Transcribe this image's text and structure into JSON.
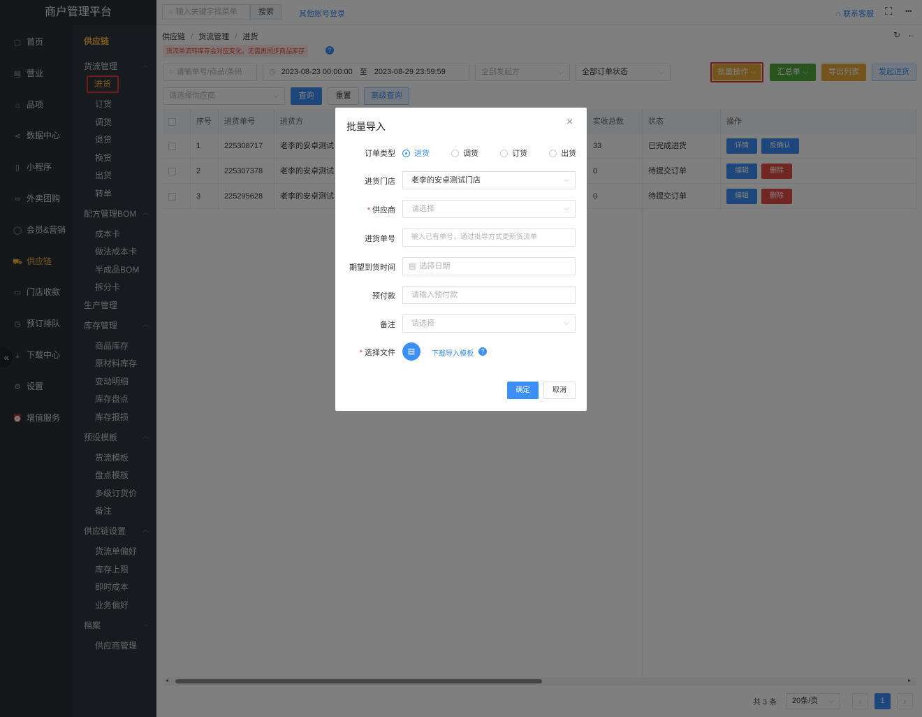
{
  "app": {
    "title": "商户管理平台"
  },
  "nav": {
    "items": [
      {
        "label": "首页",
        "icon": "home-icon",
        "glyph": "▢"
      },
      {
        "label": "营业",
        "icon": "calendar-icon",
        "glyph": "▤"
      },
      {
        "label": "品项",
        "icon": "bag-icon",
        "glyph": "⌂"
      },
      {
        "label": "数据中心",
        "icon": "share-icon",
        "glyph": "⋖"
      },
      {
        "label": "小程序",
        "icon": "phone-icon",
        "glyph": "▯"
      },
      {
        "label": "外卖团购",
        "icon": "bike-icon",
        "glyph": "∞"
      },
      {
        "label": "会员&营销",
        "icon": "user-icon",
        "glyph": "◯"
      },
      {
        "label": "供应链",
        "icon": "truck-icon",
        "glyph": "⛟"
      },
      {
        "label": "门店收款",
        "icon": "wallet-icon",
        "glyph": "▭"
      },
      {
        "label": "预订排队",
        "icon": "clock-icon",
        "glyph": "◷"
      },
      {
        "label": "下载中心",
        "icon": "download-icon",
        "glyph": "⤓"
      },
      {
        "label": "设置",
        "icon": "gear-icon",
        "glyph": "⚙"
      },
      {
        "label": "增值服务",
        "icon": "alarm-icon",
        "glyph": "⏰"
      }
    ],
    "collapse_glyph": "«"
  },
  "sub": {
    "header": "供应链",
    "groups": [
      {
        "title": "货流管理",
        "items": [
          "进货",
          "订货",
          "调货",
          "退货",
          "换货",
          "出货",
          "转单"
        ]
      },
      {
        "title": "配方管理BOM",
        "items": [
          "成本卡",
          "做法成本卡",
          "半成品BOM",
          "拆分卡"
        ]
      },
      {
        "title": "生产管理",
        "items": []
      },
      {
        "title": "库存管理",
        "items": [
          "商品库存",
          "原材料库存",
          "变动明细",
          "库存盘点",
          "库存报损"
        ]
      },
      {
        "title": "预设模板",
        "items": [
          "货流模板",
          "盘点模板",
          "多级订货价",
          "备注"
        ]
      },
      {
        "title": "供应链设置",
        "items": [
          "货流单偏好",
          "库存上限",
          "即时成本",
          "业务偏好"
        ]
      },
      {
        "title": "档案",
        "items": [
          "供应商管理"
        ]
      }
    ]
  },
  "topbar": {
    "search_placeholder": "输入关键字找菜单",
    "search_button": "搜索",
    "other_login": "其他账号登录",
    "contact": "联系客服",
    "fullscreen_glyph": "⛶",
    "more_glyph": "•••"
  },
  "breadcrumb": [
    "供应链",
    "货流管理",
    "进货"
  ],
  "notice": "货流单流转库存会对应变化，无需再同步商品库存",
  "filters": {
    "order_placeholder": "请输单号/商品/条码",
    "date_start": "2023-08-23 00:00:00",
    "date_sep": "至",
    "date_end": "2023-08-29 23:59:59",
    "initiator": "全部发起方",
    "status": "全部订单状态",
    "supplier_placeholder": "请选择供应商",
    "query": "查询",
    "reset": "重置",
    "advanced": "高级查询"
  },
  "actions": {
    "batch": "批量操作",
    "summary": "汇总单",
    "export": "导出列表",
    "start": "发起进货"
  },
  "colors": {
    "blue": "#3b8ff7",
    "green": "#52a83c",
    "orange": "#e8a83a",
    "red": "#e54d42",
    "gold": "#f4b542"
  },
  "table": {
    "headers": [
      "序号",
      "进货单号",
      "进货方",
      "实收总数",
      "状态",
      "操作"
    ],
    "rows": [
      {
        "idx": "1",
        "no": "225308717",
        "party": "老李的安卓测试",
        "qty": "33",
        "status": "已完成进货",
        "btn1": "详情",
        "btn2": "反确认"
      },
      {
        "idx": "2",
        "no": "225307378",
        "party": "老李的安卓测试",
        "qty": "0",
        "status": "待提交订单",
        "btn1": "编辑",
        "btn2": "删除"
      },
      {
        "idx": "3",
        "no": "225295628",
        "party": "老李的安卓测试",
        "qty": "0",
        "status": "待提交订单",
        "btn1": "编辑",
        "btn2": "删除"
      }
    ]
  },
  "pagination": {
    "total": "共 3 条",
    "page_size": "20条/页",
    "current": "1",
    "prev": "‹",
    "next": "›"
  },
  "modal": {
    "title": "批量导入",
    "close": "×",
    "order_type_label": "订单类型",
    "order_types": [
      "进货",
      "调货",
      "订货",
      "出货"
    ],
    "store_label": "进货门店",
    "store_value": "老李的安卓测试门店",
    "supplier_label": "供应商",
    "supplier_placeholder": "请选择",
    "order_no_label": "进货单号",
    "order_no_placeholder": "输入已有单号，通过批导方式更新货流单",
    "date_label": "期望到货时间",
    "date_placeholder": "选择日期",
    "prepay_label": "预付款",
    "prepay_placeholder": "请输入预付款",
    "remark_label": "备注",
    "remark_placeholder": "请选择",
    "file_label": "选择文件",
    "download_template": "下载导入模板",
    "confirm": "确定",
    "cancel": "取消"
  }
}
